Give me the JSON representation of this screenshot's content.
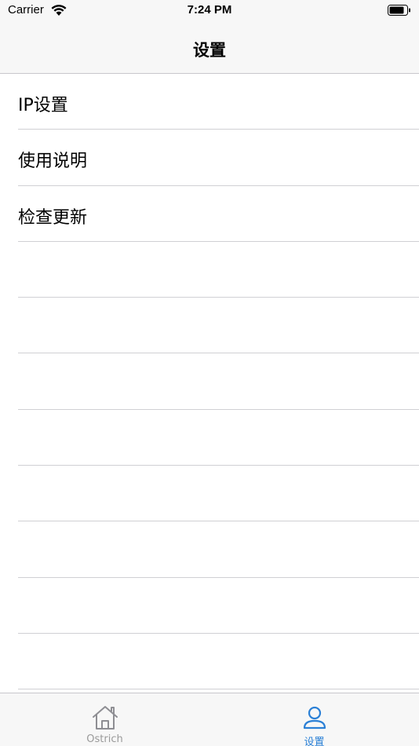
{
  "status_bar": {
    "carrier": "Carrier",
    "time": "7:24 PM",
    "wifi_icon": "wifi-icon",
    "battery_icon": "battery-icon"
  },
  "nav": {
    "title": "设置"
  },
  "list": {
    "items": [
      {
        "label": "IP设置"
      },
      {
        "label": "使用说明"
      },
      {
        "label": "检查更新"
      },
      {
        "label": ""
      },
      {
        "label": ""
      },
      {
        "label": ""
      },
      {
        "label": ""
      },
      {
        "label": ""
      },
      {
        "label": ""
      },
      {
        "label": ""
      },
      {
        "label": ""
      }
    ]
  },
  "tab_bar": {
    "tabs": [
      {
        "label": "Ostrich",
        "icon": "home-icon",
        "selected": false
      },
      {
        "label": "设置",
        "icon": "person-icon",
        "selected": true
      }
    ]
  },
  "colors": {
    "accent": "#2b80d6",
    "inactive": "#9a9a9a",
    "bar_background": "#f7f7f7",
    "separator": "#d0d0d4"
  }
}
